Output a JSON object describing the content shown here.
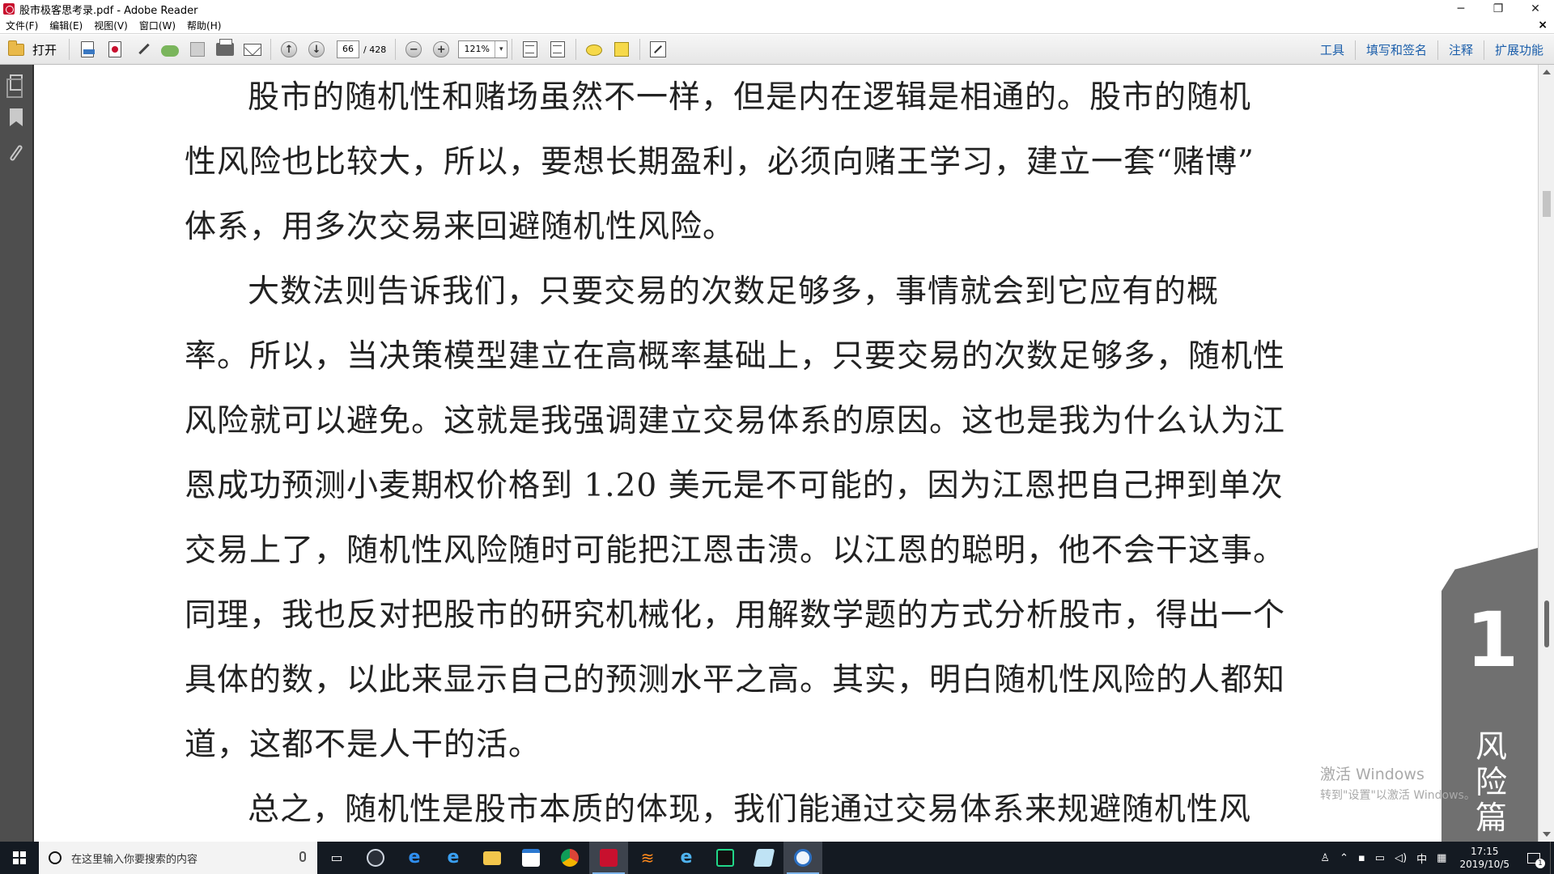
{
  "window": {
    "title": "股市极客思考录.pdf - Adobe Reader",
    "controls": [
      "─",
      "❐",
      "✕"
    ]
  },
  "menu": {
    "items": [
      "文件(F)",
      "编辑(E)",
      "视图(V)",
      "窗口(W)",
      "帮助(H)"
    ],
    "close": "×"
  },
  "toolbar": {
    "open_label": "打开",
    "page_current": "66",
    "page_total": "/ 428",
    "zoom_value": "121%",
    "zoom_dropdown": "▾",
    "prev_page": "↑",
    "next_page": "↓",
    "zoom_out": "−",
    "zoom_in": "+",
    "right_links": [
      "工具",
      "填写和签名",
      "注释",
      "扩展功能"
    ]
  },
  "document": {
    "paragraphs": [
      "股市的随机性和赌场虽然不一样，但是内在逻辑是相通的。股市的随机",
      "性风险也比较大，所以，要想长期盈利，必须向赌王学习，建立一套“赌博”",
      "体系，用多次交易来回避随机性风险。",
      "大数法则告诉我们，只要交易的次数足够多，事情就会到它应有的概",
      "率。所以，当决策模型建立在高概率基础上，只要交易的次数足够多，随机性",
      "风险就可以避免。这就是我强调建立交易体系的原因。这也是我为什么认为江",
      "恩成功预测小麦期权价格到 1.20 美元是不可能的，因为江恩把自己押到单次",
      "交易上了，随机性风险随时可能把江恩击溃。以江恩的聪明，他不会干这事。",
      "同理，我也反对把股市的研究机械化，用解数学题的方式分析股市，得出一个",
      "具体的数，以此来显示自己的预测水平之高。其实，明白随机性风险的人都知",
      "道，这都不是人干的活。",
      "总之，随机性是股市本质的体现，我们能通过交易体系来规避随机性风"
    ],
    "side_tab": {
      "number": "1",
      "text": "风险篇"
    }
  },
  "watermark": {
    "line1": "激活 Windows",
    "line2": "转到\"设置\"以激活 Windows。"
  },
  "taskbar": {
    "search_placeholder": "在这里输入你要搜索的内容",
    "tray": {
      "input_method": "中",
      "time": "17:15",
      "date": "2019/10/5",
      "notification_count": "1"
    }
  },
  "colors": {
    "taskbar": "#141a22",
    "nav_pane": "#4e4e4e",
    "link_blue": "#1c5fab",
    "side_tab": "#707070",
    "acrobat_red": "#c8102e"
  }
}
